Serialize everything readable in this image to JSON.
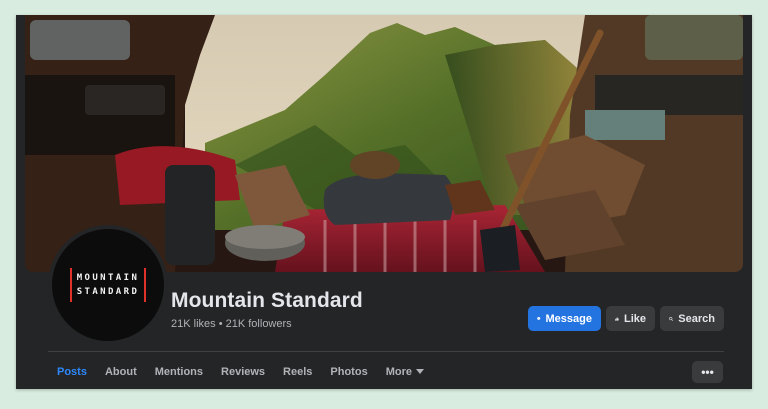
{
  "page": {
    "name": "Mountain Standard",
    "likes": "21K likes",
    "separator": "•",
    "followers": "21K followers"
  },
  "logo": {
    "line1": "MOUNTAIN",
    "line2": "STANDARD"
  },
  "actions": {
    "message_label": "Message",
    "like_label": "Like",
    "search_label": "Search",
    "more_label": "•••"
  },
  "tabs": [
    {
      "label": "Posts",
      "active": true
    },
    {
      "label": "About"
    },
    {
      "label": "Mentions"
    },
    {
      "label": "Reviews"
    },
    {
      "label": "Reels"
    },
    {
      "label": "Photos"
    },
    {
      "label": "More"
    }
  ],
  "colors": {
    "accent": "#2374e1",
    "active_tab": "#2d88ff",
    "background": "#242526",
    "logo_red": "#e0322b"
  },
  "icons": [
    "messenger-icon",
    "thumbs-up-icon",
    "search-icon",
    "caret-down-icon",
    "ellipsis-icon"
  ]
}
